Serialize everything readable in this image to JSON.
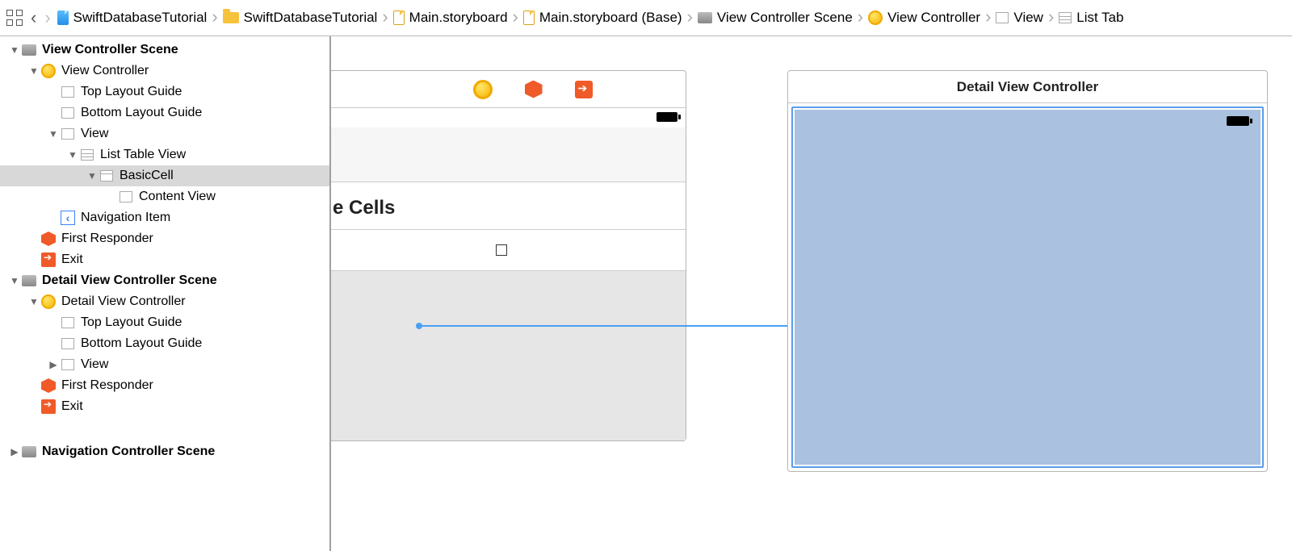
{
  "breadcrumb": {
    "project": "SwiftDatabaseTutorial",
    "folder": "SwiftDatabaseTutorial",
    "storyboard": "Main.storyboard",
    "storyboard_base": "Main.storyboard (Base)",
    "scene": "View Controller Scene",
    "vc": "View Controller",
    "view": "View",
    "table": "List Tab"
  },
  "tree": {
    "scene1": "View Controller Scene",
    "vc1": "View Controller",
    "topGuide1": "Top Layout Guide",
    "bottomGuide1": "Bottom Layout Guide",
    "view1": "View",
    "listTable": "List Table View",
    "basicCell": "BasicCell",
    "contentView": "Content View",
    "navItem": "Navigation Item",
    "firstResponder1": "First Responder",
    "exit1": "Exit",
    "scene2": "Detail View Controller Scene",
    "vc2": "Detail View Controller",
    "topGuide2": "Top Layout Guide",
    "bottomGuide2": "Bottom Layout Guide",
    "view2": "View",
    "firstResponder2": "First Responder",
    "exit2": "Exit",
    "scene3": "Navigation Controller Scene"
  },
  "canvas": {
    "cellsTitle": "e Cells",
    "detailTitle": "Detail View Controller"
  },
  "colors": {
    "selected_view_bg": "#aac2e0",
    "selection_border": "#5a9de8",
    "orange": "#f05a28",
    "yellow": "#f5b400",
    "segue": "#4aa0f3"
  }
}
